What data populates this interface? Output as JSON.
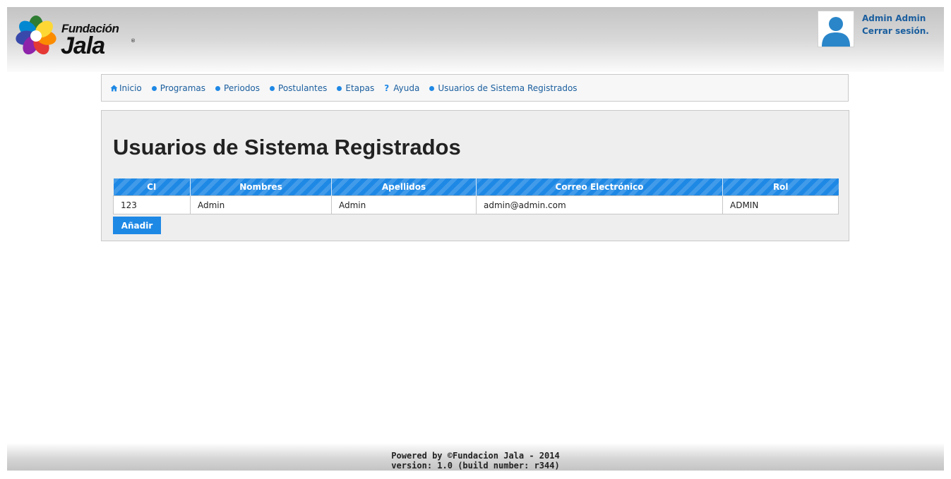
{
  "brand": {
    "line1": "Fundación",
    "line2": "Jala",
    "registered": "®"
  },
  "user": {
    "name": "Admin Admin",
    "logout_label": "Cerrar sesión."
  },
  "nav": {
    "items": [
      {
        "label": "Inicio",
        "icon": "home-icon"
      },
      {
        "label": "Programas",
        "icon": "bullet-icon"
      },
      {
        "label": "Periodos",
        "icon": "bullet-icon"
      },
      {
        "label": "Postulantes",
        "icon": "bullet-icon"
      },
      {
        "label": "Etapas",
        "icon": "bullet-icon"
      },
      {
        "label": "Ayuda",
        "icon": "help-icon"
      },
      {
        "label": "Usuarios de Sistema Registrados",
        "icon": "bullet-icon"
      }
    ]
  },
  "page": {
    "title": "Usuarios de Sistema Registrados"
  },
  "table": {
    "columns": [
      "CI",
      "Nombres",
      "Apellidos",
      "Correo Electrónico",
      "Rol"
    ],
    "rows": [
      [
        "123",
        "Admin",
        "Admin",
        "admin@admin.com",
        "ADMIN"
      ]
    ]
  },
  "actions": {
    "add_label": "Añadir"
  },
  "footer": {
    "line1": "Powered by ©Fundacion Jala - 2014",
    "line2": "version: 1.0 (build number: r344)"
  },
  "colors": {
    "accent": "#1e88e5",
    "link": "#1a5e9e",
    "panel": "#eeeeee"
  }
}
